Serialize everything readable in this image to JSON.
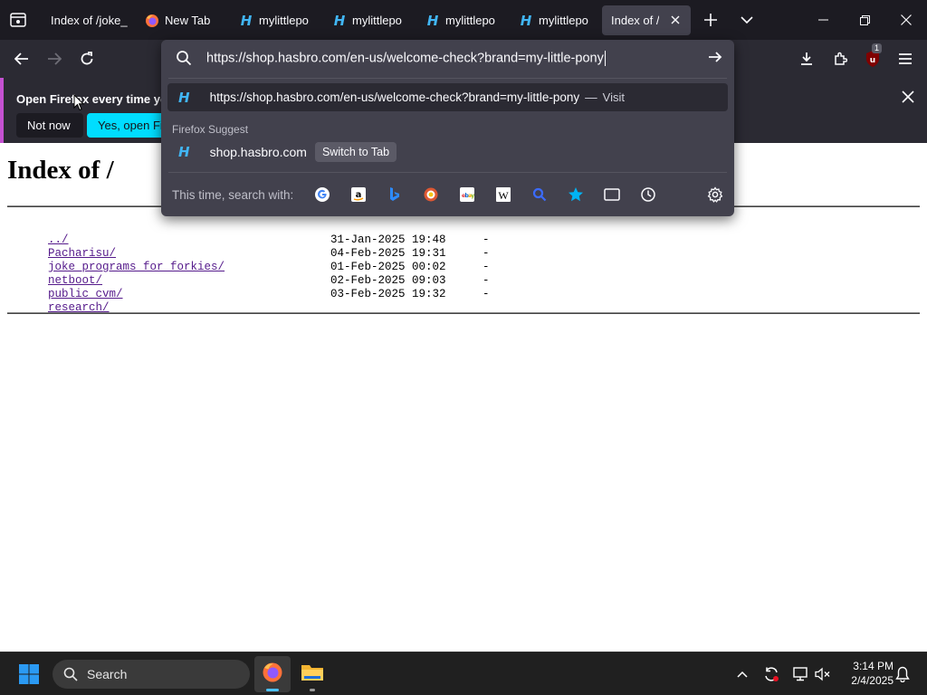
{
  "tabs": [
    {
      "title": "Index of /joke_",
      "favicon": "none"
    },
    {
      "title": "New Tab",
      "favicon": "firefox-icon"
    },
    {
      "title": "mylittlepo",
      "favicon": "hasbro-icon"
    },
    {
      "title": "mylittlepo",
      "favicon": "hasbro-icon"
    },
    {
      "title": "mylittlepo",
      "favicon": "hasbro-icon"
    },
    {
      "title": "mylittlepo",
      "favicon": "hasbro-icon"
    },
    {
      "title": "Index of /",
      "favicon": "none",
      "active": true
    }
  ],
  "address_bar": {
    "url": "https://shop.hasbro.com/en-us/welcome-check?brand=my-little-pony"
  },
  "dropdown": {
    "first_result": {
      "url": "https://shop.hasbro.com/en-us/welcome-check?brand=my-little-pony",
      "separator": "—",
      "action": "Visit"
    },
    "suggest_header": "Firefox Suggest",
    "suggest_item": {
      "label": "shop.hasbro.com",
      "action": "Switch to Tab"
    },
    "search_with_label": "This time, search with:",
    "engines": [
      "google-icon",
      "amazon-icon",
      "bing-icon",
      "duckduckgo-icon",
      "ebay-icon",
      "wikipedia-icon",
      "search-icon",
      "bookmarks-star-icon",
      "tabs-icon",
      "history-icon",
      "settings-gear-icon"
    ]
  },
  "notification": {
    "text": "Open Firefox every time you",
    "not_now": "Not now",
    "yes_open": "Yes, open Firefox"
  },
  "extension_badge": "1",
  "page": {
    "heading": "Index of /",
    "parent_link": "../",
    "entries": [
      {
        "name": "Pacharisu/",
        "date": "31-Jan-2025 19:48",
        "size": "-"
      },
      {
        "name": "joke_programs_for_forkies/",
        "date": "04-Feb-2025 19:31",
        "size": "-"
      },
      {
        "name": "netboot/",
        "date": "01-Feb-2025 00:02",
        "size": "-"
      },
      {
        "name": "public_cvm/",
        "date": "02-Feb-2025 09:03",
        "size": "-"
      },
      {
        "name": "research/",
        "date": "03-Feb-2025 19:32",
        "size": "-"
      }
    ]
  },
  "taskbar": {
    "search_label": "Search",
    "time": "3:14 PM",
    "date": "2/4/2025"
  },
  "colors": {
    "accent_cyan": "#00ddff",
    "link": "#551a8b",
    "chrome_dark": "#1c1b22",
    "chrome_mid": "#2b2a33"
  }
}
